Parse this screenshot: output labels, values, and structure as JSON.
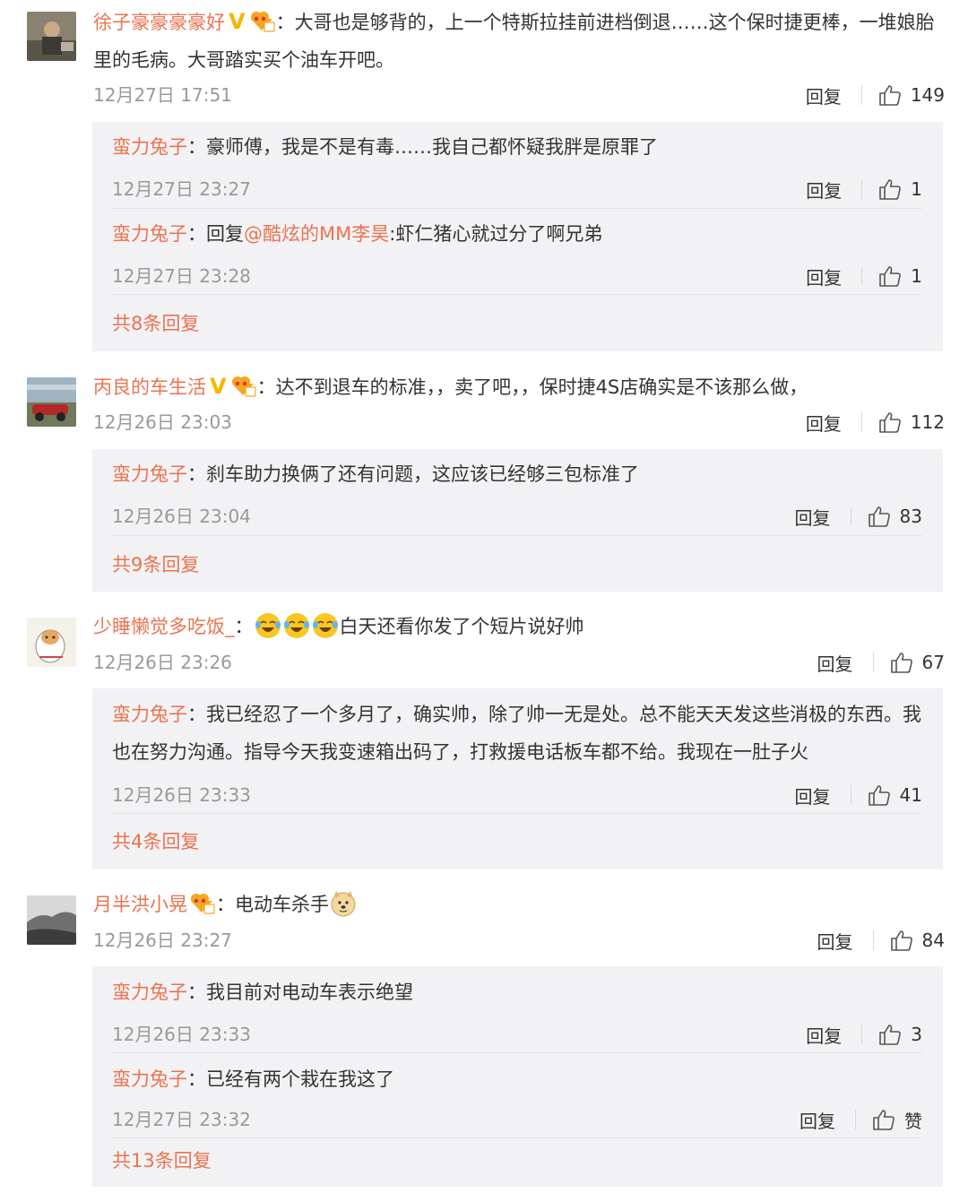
{
  "comments": [
    {
      "user": "徐子豪豪豪豪好",
      "verified": "V",
      "text": "大哥也是够背的，上一个特斯拉挂前进档倒退……这个保时捷更棒，一堆娘胎里的毛病。大哥踏实买个油车开吧。",
      "time": "12月27日 17:51",
      "likes": "149",
      "replies": [
        {
          "user": "蛮力兔子",
          "text": "豪师傅，我是不是有毒……我自己都怀疑我胖是原罪了",
          "time": "12月27日 23:27",
          "likes": "1"
        },
        {
          "user": "蛮力兔子",
          "text_prefix": "回复",
          "mention": "@酷炫的MM李昊",
          "text": ":虾仁猪心就过分了啊兄弟",
          "time": "12月27日 23:28",
          "likes": "1"
        }
      ],
      "more": "共8条回复"
    },
    {
      "user": "丙良的车生活",
      "verified": "V",
      "text": "达不到退车的标准，，卖了吧，，保时捷4S店确实是不该那么做，",
      "time": "12月26日 23:03",
      "likes": "112",
      "replies": [
        {
          "user": "蛮力兔子",
          "text": "刹车助力换俩了还有问题，这应该已经够三包标准了",
          "time": "12月26日 23:04",
          "likes": "83"
        }
      ],
      "more": "共9条回复"
    },
    {
      "user": "少睡懒觉多吃饭_",
      "text": "白天还看你发了个短片说好帅",
      "time": "12月26日 23:26",
      "likes": "67",
      "replies": [
        {
          "user": "蛮力兔子",
          "text": "我已经忍了一个多月了，确实帅，除了帅一无是处。总不能天天发这些消极的东西。我也在努力沟通。指导今天我变速箱出码了，打救援电话板车都不给。我现在一肚子火",
          "time": "12月26日 23:33",
          "likes": "41"
        }
      ],
      "more": "共4条回复"
    },
    {
      "user": "月半洪小晃",
      "text": "电动车杀手",
      "time": "12月26日 23:27",
      "likes": "84",
      "replies": [
        {
          "user": "蛮力兔子",
          "text": "我目前对电动车表示绝望",
          "time": "12月26日 23:33",
          "likes": "3"
        },
        {
          "user": "蛮力兔子",
          "text": "已经有两个栽在我这了",
          "time": "12月27日 23:32",
          "likes": "赞"
        }
      ],
      "more": "共13条回复"
    }
  ],
  "ui": {
    "colon": "：",
    "reply_label": "回复"
  },
  "colors": {
    "username": "#eb7350",
    "verified_badge": "#f7b500",
    "sub_background": "#f2f2f5",
    "meta_text": "#999999"
  }
}
